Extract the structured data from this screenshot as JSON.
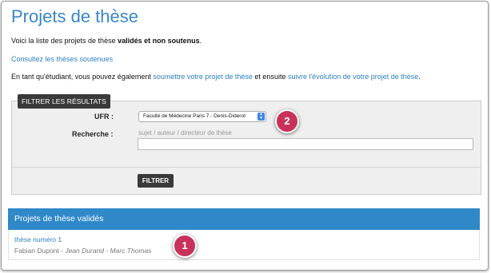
{
  "page": {
    "title": "Projets de thèse",
    "intro_prefix": "Voici la liste des projets de thèse ",
    "intro_bold": "validés et non soutenus",
    "intro_suffix": ".",
    "link_soutenues": "Consultez les thèses soutenues",
    "student_prefix": "En tant qu'étudiant, vous pouvez également ",
    "student_link1": "soumettre votre projet de thèse",
    "student_mid": " et ensuite ",
    "student_link2": "suivre l'évolution de votre projet de thèse",
    "student_suffix": "."
  },
  "filter": {
    "legend": "FILTRER LES RÉSULTATS",
    "ufr_label": "UFR :",
    "ufr_value": "Faculté de Médecine Paris 7 - Denis-Diderot",
    "recherche_label": "Recherche :",
    "recherche_hint": "sujet / auteur / directeur de thèse",
    "recherche_value": "",
    "button_label": "FILTRER"
  },
  "results": {
    "header": "Projets de thèse validés",
    "items": [
      {
        "title": "thèse numéro 1",
        "author": "Fabian Dupont",
        "sep": " - ",
        "directors": "Jean Durand - Marc Thomas"
      }
    ]
  },
  "annotations": {
    "badge_1": "1",
    "badge_2": "2"
  },
  "colors": {
    "accent": "#2f89c8",
    "link": "#2f7fbf",
    "badge": "#c8325a",
    "dark_button": "#3a3a3a"
  }
}
